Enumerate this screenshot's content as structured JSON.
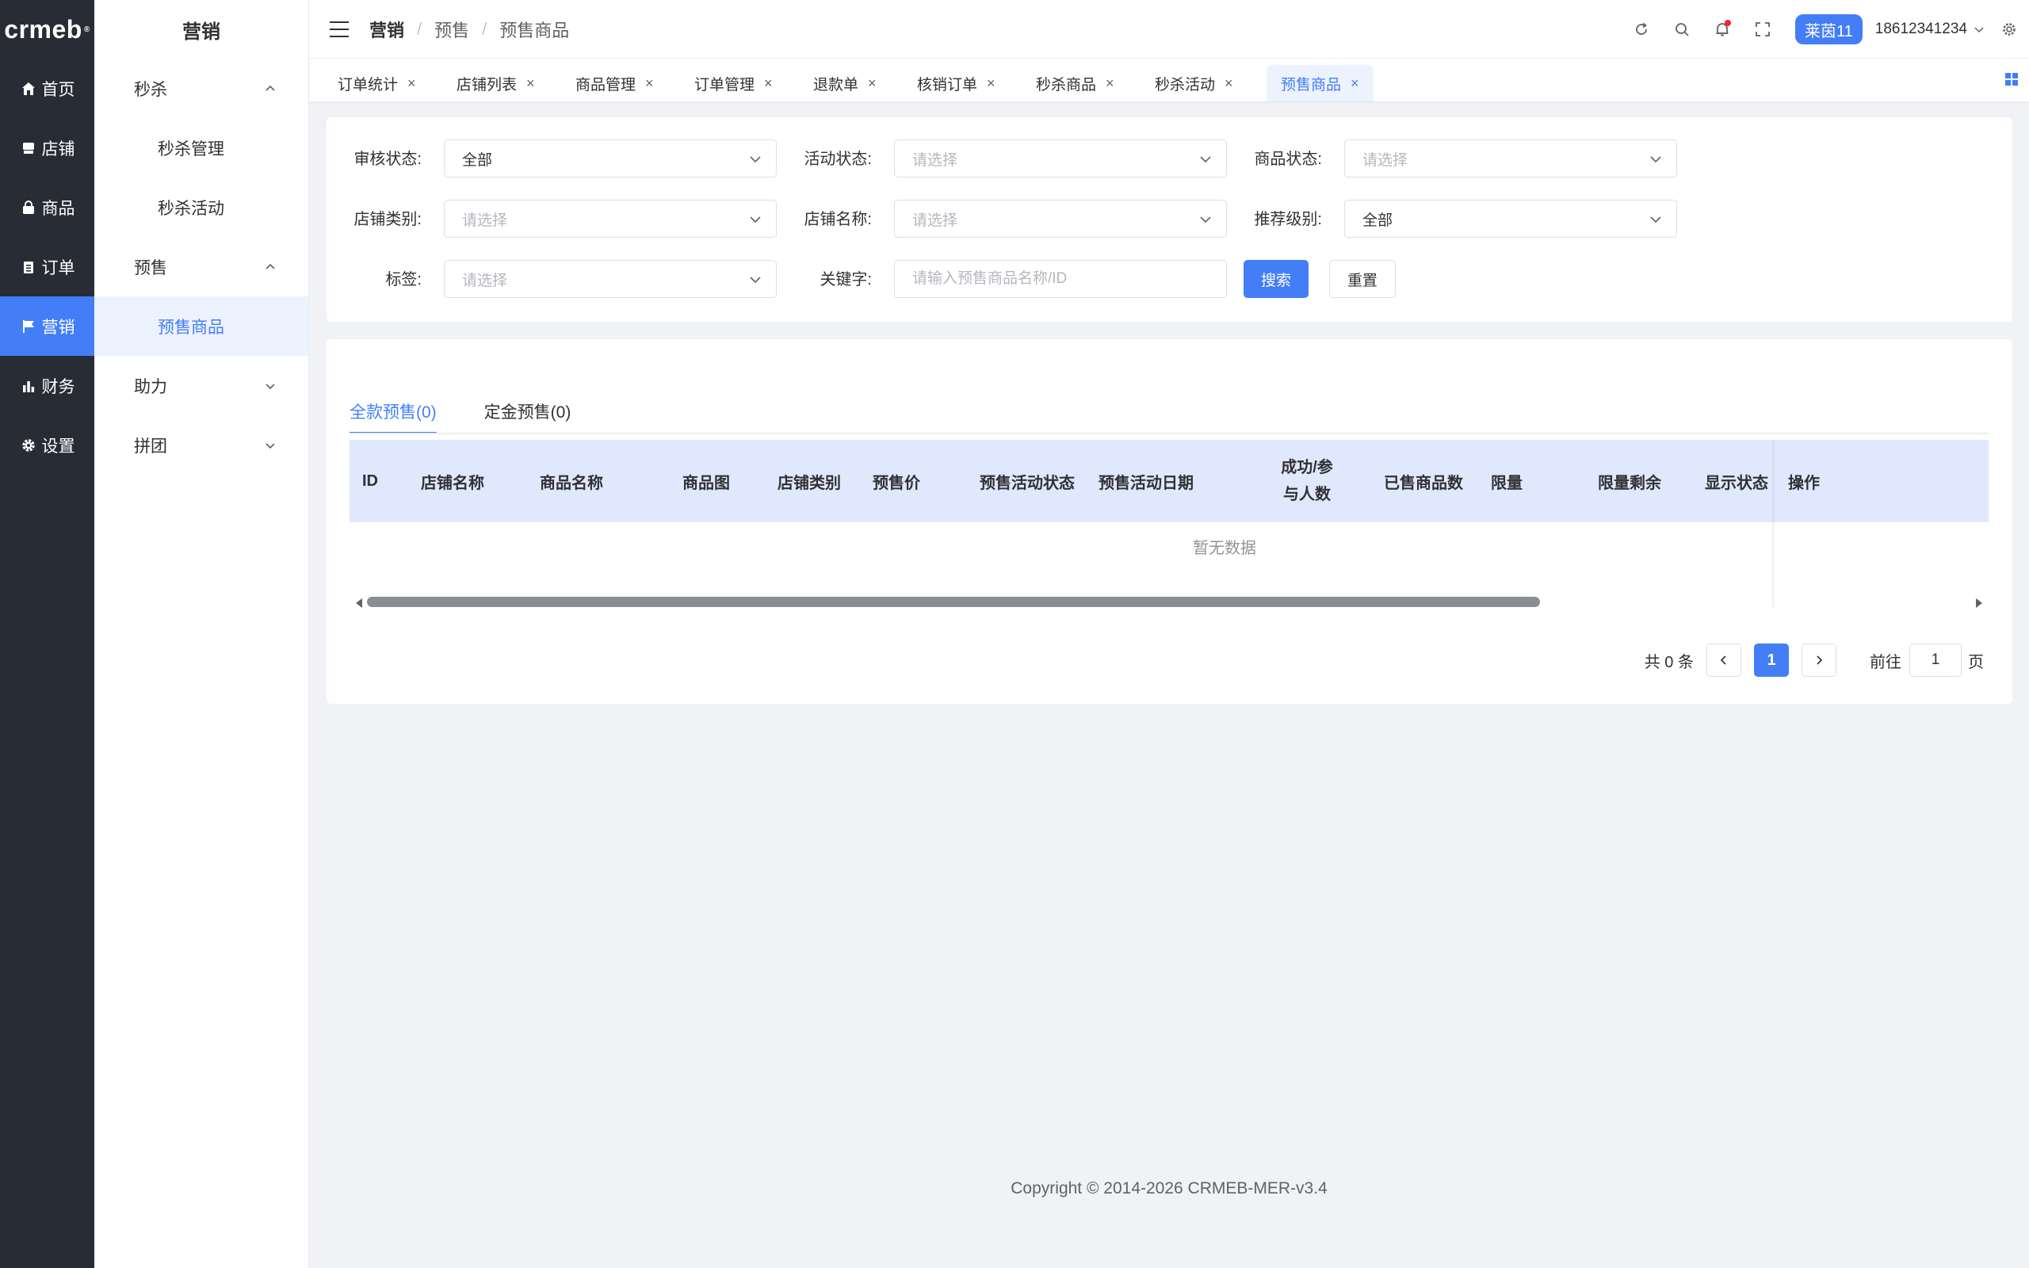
{
  "app": {
    "logo": "crmeb",
    "logo_mark": "®"
  },
  "rail": {
    "items": [
      {
        "label": "首页",
        "icon": "home-icon"
      },
      {
        "label": "店铺",
        "icon": "store-icon"
      },
      {
        "label": "商品",
        "icon": "bag-icon"
      },
      {
        "label": "订单",
        "icon": "clipboard-icon"
      },
      {
        "label": "营销",
        "icon": "flag-icon",
        "active": true
      },
      {
        "label": "财务",
        "icon": "bar-chart-icon"
      },
      {
        "label": "设置",
        "icon": "gear-icon"
      }
    ]
  },
  "submenu": {
    "title": "营销",
    "groups": [
      {
        "label": "秒杀",
        "expanded": true,
        "items": [
          "秒杀管理",
          "秒杀活动"
        ]
      },
      {
        "label": "预售",
        "expanded": true,
        "items": [
          "预售商品"
        ]
      },
      {
        "label": "助力",
        "expanded": false,
        "items": []
      },
      {
        "label": "拼团",
        "expanded": false,
        "items": []
      }
    ]
  },
  "header": {
    "breadcrumb": [
      "营销",
      "预售",
      "预售商品"
    ],
    "breadcrumb_sep": "/",
    "store_badge": "莱茵11",
    "user_phone": "18612341234"
  },
  "tabs": [
    {
      "label": "订单统计"
    },
    {
      "label": "店铺列表"
    },
    {
      "label": "商品管理"
    },
    {
      "label": "订单管理"
    },
    {
      "label": "退款单"
    },
    {
      "label": "核销订单"
    },
    {
      "label": "秒杀商品"
    },
    {
      "label": "秒杀活动"
    },
    {
      "label": "预售商品",
      "active": true
    }
  ],
  "tab_close_glyph": "×",
  "filters": {
    "audit_status": {
      "label": "审核状态:",
      "value": "全部"
    },
    "activity_status": {
      "label": "活动状态:",
      "placeholder": "请选择"
    },
    "product_status": {
      "label": "商品状态:",
      "placeholder": "请选择"
    },
    "store_type": {
      "label": "店铺类别:",
      "placeholder": "请选择"
    },
    "store_name": {
      "label": "店铺名称:",
      "placeholder": "请选择"
    },
    "recommend_level": {
      "label": "推荐级别:",
      "value": "全部"
    },
    "tag": {
      "label": "标签:",
      "placeholder": "请选择"
    },
    "keyword": {
      "label": "关键字:",
      "placeholder": "请输入预售商品名称/ID",
      "value": ""
    },
    "search_button": "搜索",
    "reset_button": "重置"
  },
  "table": {
    "tabs": [
      "全款预售(0)",
      "定金预售(0)"
    ],
    "columns": [
      "ID",
      "店铺名称",
      "商品名称",
      "商品图",
      "店铺类别",
      "预售价",
      "预售活动状态",
      "预售活动日期",
      "成功/参与人数",
      "已售商品数",
      "限量",
      "限量剩余",
      "显示状态",
      "操作"
    ],
    "rows": [],
    "empty_text": "暂无数据"
  },
  "pagination": {
    "total_text": "共 0 条",
    "current_page": "1",
    "goto_label": "前往",
    "goto_value": "1",
    "page_unit": "页"
  },
  "footer": {
    "copyright": "Copyright © 2014-2026 CRMEB-MER-v3.4"
  },
  "colors": {
    "primary": "#437ef7",
    "rail_bg": "#282c34",
    "table_header_bg": "#dfe8fd",
    "page_bg": "#f0f2f5"
  }
}
